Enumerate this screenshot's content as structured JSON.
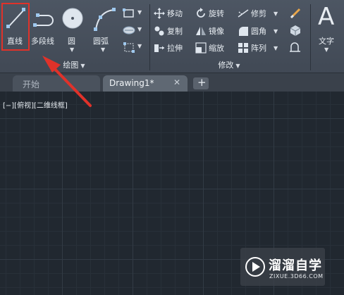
{
  "ribbon": {
    "draw_panel": {
      "title": "绘图",
      "line_label": "直线",
      "polyline_label": "多段线",
      "circle_label": "圆",
      "arc_label": "圆弧"
    },
    "modify_panel": {
      "title": "修改",
      "move": "移动",
      "rotate": "旋转",
      "trim": "修剪",
      "copy": "复制",
      "mirror": "镜像",
      "fillet": "圆角",
      "stretch": "拉伸",
      "scale": "缩放",
      "array": "阵列"
    },
    "text_label": "文字",
    "text_glyph": "A"
  },
  "tabs": [
    {
      "label": "开始"
    },
    {
      "label": "Drawing1*"
    }
  ],
  "viewport": {
    "label": "[−][俯视][二维线框]"
  },
  "watermark": {
    "name": "溜溜自学",
    "url": "ZIXUE.3D66.COM"
  },
  "colors": {
    "highlight_box": "#e0322a",
    "annotation_arrow": "#e0322a",
    "canvas": "#212830",
    "ribbon": "#454d58"
  }
}
